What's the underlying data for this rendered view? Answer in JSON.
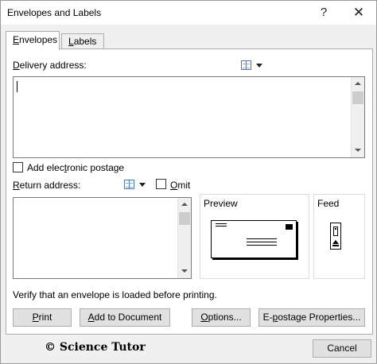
{
  "window": {
    "title": "Envelopes and Labels",
    "help_glyph": "?",
    "close_glyph": "✕"
  },
  "tabs": [
    {
      "label_prefix": "",
      "mnemonic": "E",
      "label_rest": "nvelopes"
    },
    {
      "label_prefix": "",
      "mnemonic": "L",
      "label_rest": "abels"
    }
  ],
  "delivery": {
    "label_mnemonic": "D",
    "label_rest": "elivery address:",
    "value": ""
  },
  "epostage": {
    "label_prefix": "Add elec",
    "label_mnemonic": "t",
    "label_rest": "ronic postage",
    "checked": false
  },
  "return_address": {
    "label_mnemonic": "R",
    "label_rest": "eturn address:",
    "value": ""
  },
  "omit": {
    "label_mnemonic": "O",
    "label_rest": "mit",
    "checked": false
  },
  "preview": {
    "title": "Preview"
  },
  "feed": {
    "title": "Feed"
  },
  "status_text": "Verify that an envelope is loaded before printing.",
  "buttons": {
    "print": {
      "mnemonic": "P",
      "rest": "rint"
    },
    "add_to_document": {
      "mnemonic": "A",
      "rest": "dd to Document"
    },
    "options": {
      "mnemonic": "O",
      "rest": "ptions..."
    },
    "epostage_properties": {
      "prefix": "E-",
      "mnemonic": "p",
      "rest": "ostage Properties..."
    },
    "cancel": "Cancel"
  },
  "watermark": "© Science Tutor"
}
